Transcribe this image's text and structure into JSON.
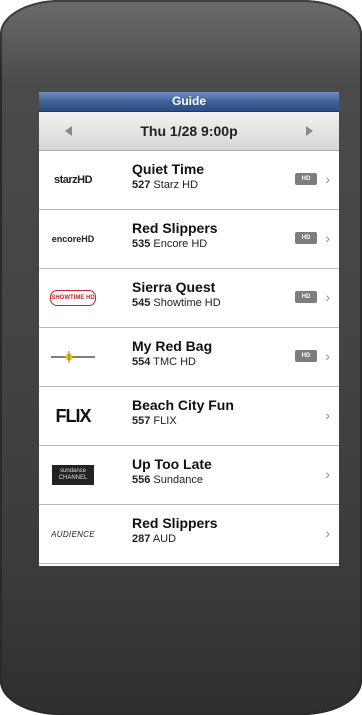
{
  "header": {
    "title": "Guide"
  },
  "datebar": {
    "date_label": "Thu 1/28 9:00p"
  },
  "rows": [
    {
      "logo_text": "starzHD",
      "title": "Quiet Time",
      "channel_number": "527",
      "channel_name": "Starz HD",
      "hd_badge": "HD",
      "hd": true
    },
    {
      "logo_text": "encoreHD",
      "title": "Red Slippers",
      "channel_number": "535",
      "channel_name": "Encore HD",
      "hd_badge": "HD",
      "hd": true
    },
    {
      "logo_text": "SHOWTIME HD",
      "title": "Sierra Quest",
      "channel_number": "545",
      "channel_name": "Showtime HD",
      "hd_badge": "HD",
      "hd": true
    },
    {
      "logo_text": "",
      "title": "My Red Bag",
      "channel_number": "554",
      "channel_name": "TMC HD",
      "hd_badge": "HD",
      "hd": true
    },
    {
      "logo_text": "FLIX",
      "title": "Beach City Fun",
      "channel_number": "557",
      "channel_name": "FLIX",
      "hd": false
    },
    {
      "logo_text": "sundance CHANNEL",
      "title": "Up Too Late",
      "channel_number": "556",
      "channel_name": "Sundance",
      "hd": false
    },
    {
      "logo_text": "AUDIENCE",
      "title": "Red Slippers",
      "channel_number": "287",
      "channel_name": "AUD",
      "hd": false
    }
  ],
  "icons": {
    "prev": "left-triangle-arrow",
    "next": "right-triangle-arrow",
    "row_disclosure": "chevron-right"
  },
  "colors": {
    "titlebar": "#3b5f94",
    "hd_badge": "#7d7d7d",
    "device_body": "#444444"
  }
}
